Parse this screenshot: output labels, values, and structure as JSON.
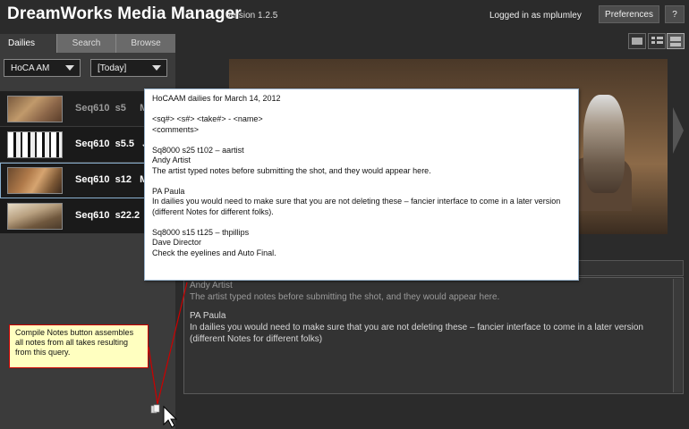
{
  "header": {
    "app_title": "DreamWorks Media Manager",
    "version": "version 1.2.5",
    "logged_in": "Logged in as mplumley",
    "preferences_label": "Preferences",
    "help_label": "?"
  },
  "left": {
    "tabs": [
      {
        "label": "Dailies",
        "active": true
      },
      {
        "label": "Search",
        "active": false
      },
      {
        "label": "Browse",
        "active": false
      }
    ],
    "project_select": {
      "value": "HoCA AM"
    },
    "date_select": {
      "value": "[Today]"
    },
    "shots": [
      {
        "label": "Seq610  s5     M",
        "state": "dim"
      },
      {
        "label": "Seq610  s5.5   J",
        "state": "normal"
      },
      {
        "label": "Seq610  s12   M",
        "state": "selected"
      },
      {
        "label": "Seq610  s22.2",
        "state": "normal"
      }
    ]
  },
  "right": {
    "view_icons": [
      "single-view-icon",
      "list-view-icon",
      "split-view-icon"
    ],
    "notes": {
      "entries": [
        {
          "author": "Andy Artist",
          "text": "The artist typed notes before submitting the shot, and they would appear here."
        },
        {
          "author": "PA Paula",
          "text": "In dailies you would need to make sure that you are not deleting these – fancier interface to come in a later version (different Notes for different folks)"
        }
      ]
    }
  },
  "popup": {
    "title": "HoCAAM dailies for March 14, 2012",
    "format_line1": "<sq#> <s#> <take#> - <name>",
    "format_line2": "<comments>",
    "entries": [
      {
        "header": "Sq8000 s25 t102 – aartist",
        "author": "Andy Artist",
        "text": "The artist typed notes before submitting the shot, and they would appear here."
      },
      {
        "header": "",
        "author": "PA Paula",
        "text": "In dailies you would need to make sure that you are not deleting these – fancier interface to come in a later version (different Notes for different folks)."
      },
      {
        "header": "Sq8000 s15 t125 – thpillips",
        "author": "Dave Director",
        "text": "Check the eyelines and Auto Final."
      }
    ]
  },
  "callout": {
    "text": "Compile Notes button assembles all notes from all takes resulting from this query."
  }
}
